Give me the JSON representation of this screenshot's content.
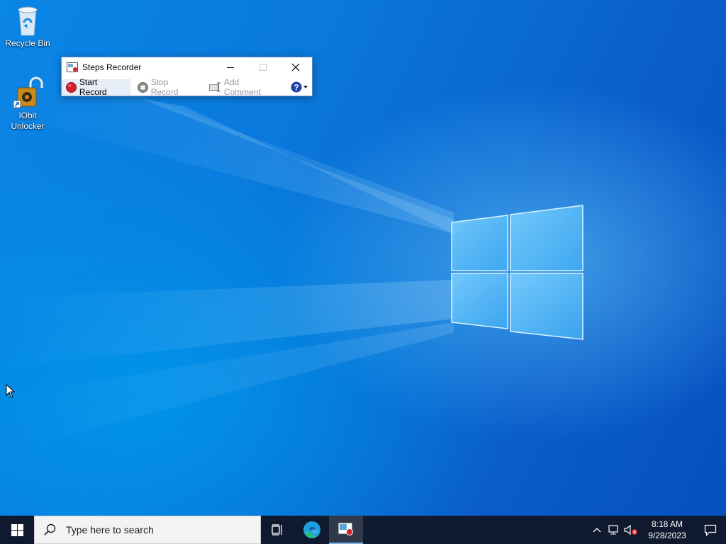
{
  "desktop": {
    "icons": [
      {
        "label": "Recycle Bin",
        "icon": "recycle-bin-icon"
      },
      {
        "label": "IObit Unlocker",
        "icon": "iobit-unlocker-icon"
      }
    ]
  },
  "steps_recorder": {
    "title": "Steps Recorder",
    "controls": {
      "minimize": "minimize-icon",
      "maximize": "maximize-icon",
      "close": "close-icon"
    },
    "toolbar": {
      "start_record": "Start Record",
      "stop_record": "Stop Record",
      "add_comment": "Add Comment",
      "help": "help-icon"
    }
  },
  "taskbar": {
    "search_placeholder": "Type here to search",
    "apps": [
      "task-view-icon",
      "edge-icon",
      "steps-recorder-icon"
    ],
    "clock": {
      "time": "8:18 AM",
      "date": "9/28/2023"
    }
  },
  "colors": {
    "record_red": "#d3202a",
    "taskbar_bg": "#0f1a2e",
    "wallpaper_blue": "#0a78dc",
    "help_blue": "#1f3fa8"
  }
}
